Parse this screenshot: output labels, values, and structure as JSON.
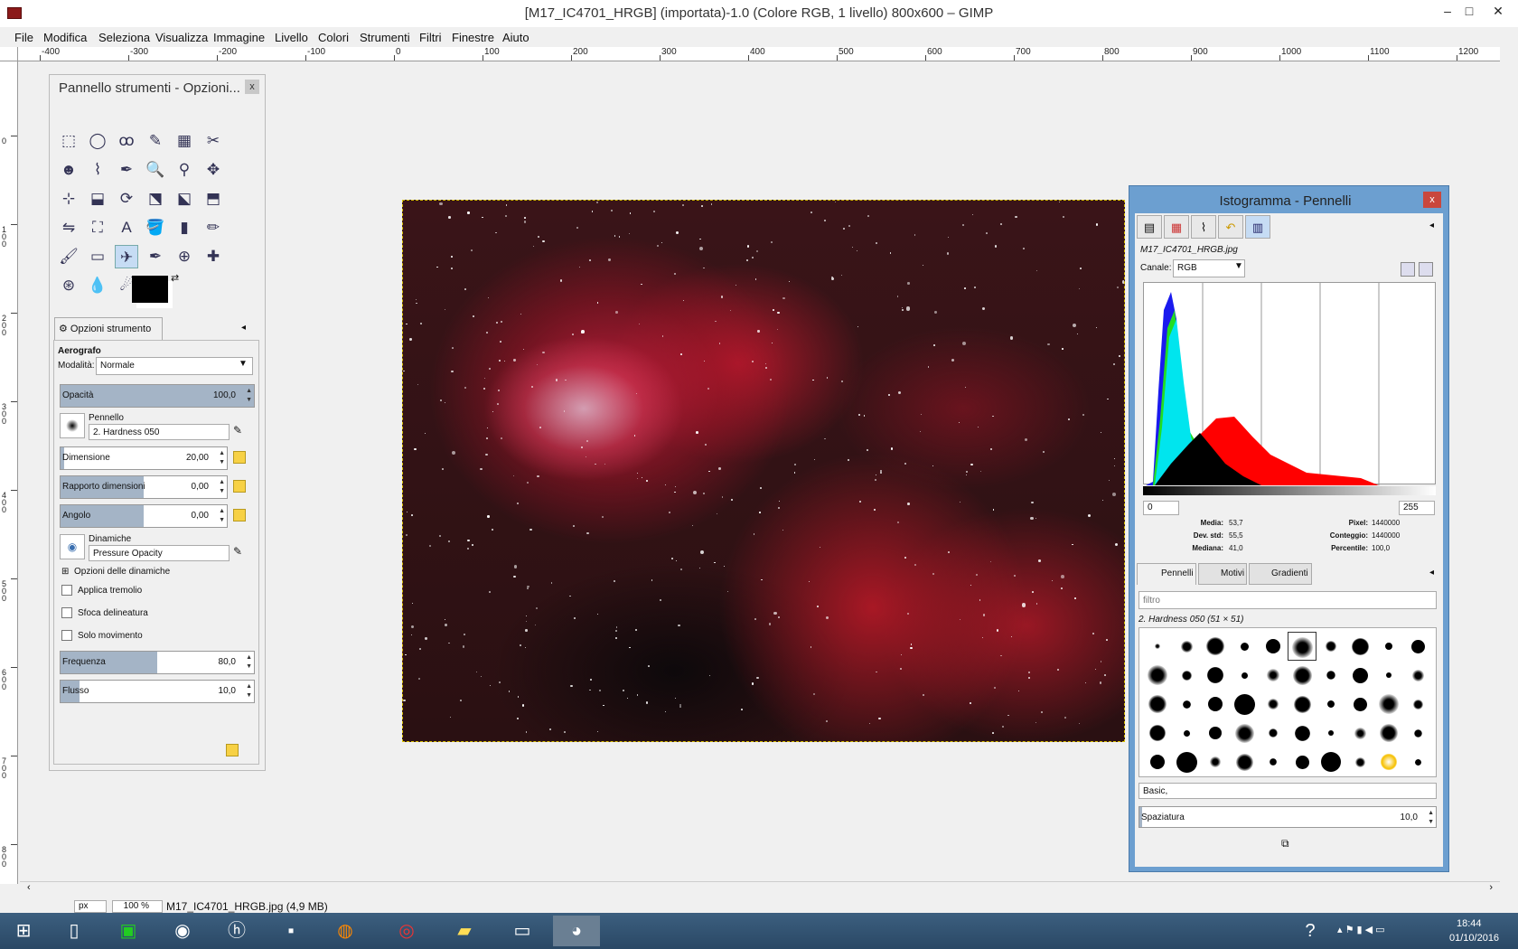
{
  "window": {
    "title": "[M17_IC4701_HRGB] (importata)-1.0 (Colore RGB, 1 livello) 800x600 – GIMP",
    "minimize": "–",
    "maximize": "□",
    "close": "✕"
  },
  "menu": [
    "File",
    "Modifica",
    "Seleziona",
    "Visualizza",
    "Immagine",
    "Livello",
    "Colori",
    "Strumenti",
    "Filtri",
    "Finestre",
    "Aiuto"
  ],
  "ruler_top": [
    "-400",
    "-300",
    "-200",
    "-100",
    "0",
    "100",
    "200",
    "300",
    "400",
    "500",
    "600",
    "700",
    "800",
    "900",
    "1000",
    "1100",
    "1200"
  ],
  "ruler_left": [
    "0",
    "100",
    "200",
    "300",
    "400",
    "500",
    "600",
    "700",
    "800"
  ],
  "toolbox": {
    "title": "Pannello strumenti - Opzioni...",
    "close": "x",
    "tools": [
      "rect-select",
      "ellipse-select",
      "free-select",
      "fuzzy-select",
      "color-select",
      "scissors",
      "foreground-select",
      "paths",
      "color-picker",
      "zoom",
      "measure",
      "move",
      "align",
      "crop",
      "rotate",
      "scale",
      "shear",
      "perspective",
      "flip",
      "cage",
      "text",
      "bucket-fill",
      "blend",
      "pencil",
      "paintbrush",
      "eraser",
      "airbrush",
      "ink",
      "clone",
      "heal",
      "perspective-clone",
      "blur",
      "smudge",
      "dodge-burn"
    ],
    "tool_glyphs": [
      "⬚",
      "◯",
      "ꝏ",
      "✎",
      "▦",
      "✂",
      "☻",
      "⌇",
      "✒",
      "🔍",
      "⚲",
      "✥",
      "⊹",
      "⬓",
      "⟳",
      "⬔",
      "⬕",
      "⬒",
      "⇋",
      "⛶",
      "A",
      "🪣",
      "▮",
      "✏",
      "🖌",
      "▭",
      "✈",
      "✒",
      "⊕",
      "✚",
      "⊛",
      "💧",
      "☄",
      "◐"
    ],
    "selected_tool_index": 26,
    "options_tab": "Opzioni strumento",
    "tool_name": "Aerografo",
    "mode_label": "Modalità:",
    "mode_value": "Normale",
    "opacity_label": "Opacità",
    "opacity_value": "100,0",
    "opacity_fraction": 1.0,
    "brush_label": "Pennello",
    "brush_value": "2. Hardness 050",
    "size_label": "Dimensione",
    "size_value": "20,00",
    "size_fraction": 0.02,
    "ratio_label": "Rapporto dimensioni",
    "ratio_value": "0,00",
    "ratio_fraction": 0.5,
    "angle_label": "Angolo",
    "angle_value": "0,00",
    "angle_fraction": 0.5,
    "dyn_label": "Dinamiche",
    "dyn_value": "Pressure Opacity",
    "dyn_options": "Opzioni delle dinamiche",
    "jitter": "Applica tremolio",
    "smooth": "Sfoca delineatura",
    "motion": "Solo movimento",
    "rate_label": "Frequenza",
    "rate_value": "80,0",
    "rate_fraction": 0.5,
    "flow_label": "Flusso",
    "flow_value": "10,0",
    "flow_fraction": 0.1
  },
  "dock": {
    "title": "Istogramma - Pennelli",
    "close": "x",
    "image_name": "M17_IC4701_HRGB.jpg",
    "channel_label": "Canale:",
    "channel_value": "RGB",
    "range_min": "0",
    "range_max": "255",
    "stats": {
      "media_l": "Media:",
      "media_v": "53,7",
      "dev_l": "Dev. std:",
      "dev_v": "55,5",
      "mediana_l": "Mediana:",
      "mediana_v": "41,0",
      "pixel_l": "Pixel:",
      "pixel_v": "1440000",
      "conteggio_l": "Conteggio:",
      "conteggio_v": "1440000",
      "percentile_l": "Percentile:",
      "percentile_v": "100,0"
    },
    "tabs": [
      "Pennelli",
      "Motivi",
      "Gradienti"
    ],
    "filter_placeholder": "filtro",
    "brush_selected": "2. Hardness 050 (51 × 51)",
    "brush_tag": "Basic,",
    "spacing_label": "Spaziatura",
    "spacing_value": "10,0"
  },
  "status": {
    "unit": "px",
    "zoom": "100 %",
    "file": "M17_IC4701_HRGB.jpg (4,9 MB)"
  },
  "taskbar": {
    "time": "18:44",
    "date": "01/10/2016"
  }
}
